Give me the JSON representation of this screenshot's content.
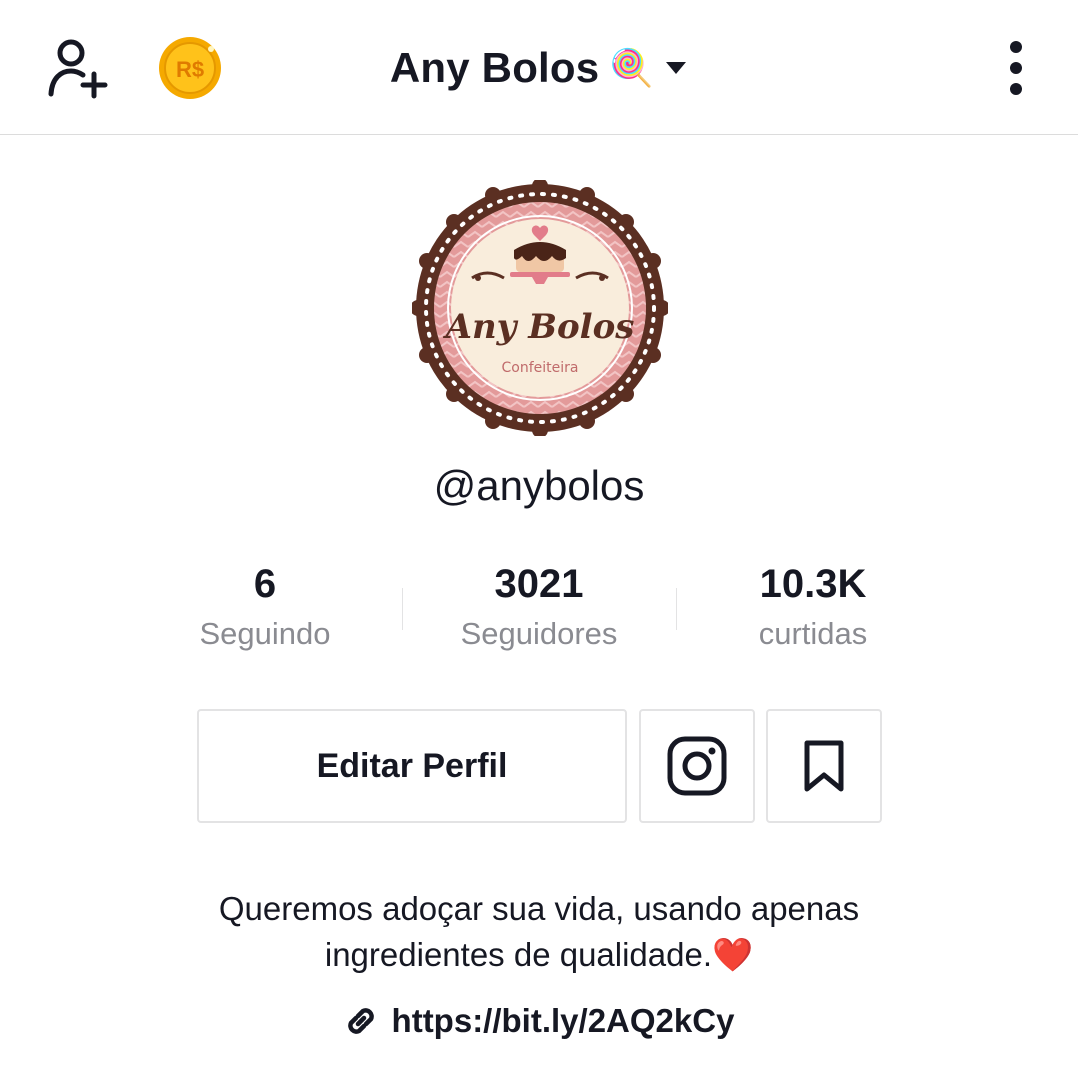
{
  "header": {
    "title": "Any Bolos",
    "title_emoji": "🍭",
    "coin_label": "R$"
  },
  "profile": {
    "avatar_text": {
      "name": "Any Bolos",
      "subtitle": "Confeiteira"
    },
    "handle": "@anybolos"
  },
  "stats": [
    {
      "value": "6",
      "label": "Seguindo"
    },
    {
      "value": "3021",
      "label": "Seguidores"
    },
    {
      "value": "10.3K",
      "label": "curtidas"
    }
  ],
  "actions": {
    "edit_label": "Editar Perfil"
  },
  "bio": {
    "line1": "Queremos adoçar sua vida, usando apenas",
    "line2": "ingredientes de qualidade.",
    "emoji": "❤️"
  },
  "link": {
    "url": "https://bit.ly/2AQ2kCy"
  },
  "colors": {
    "text": "#161823",
    "secondary": "#8a8b91",
    "border": "#e3e3e4",
    "coin": "#f7b500",
    "avatar_brown": "#5b2f22",
    "avatar_pink": "#d98a8a"
  }
}
